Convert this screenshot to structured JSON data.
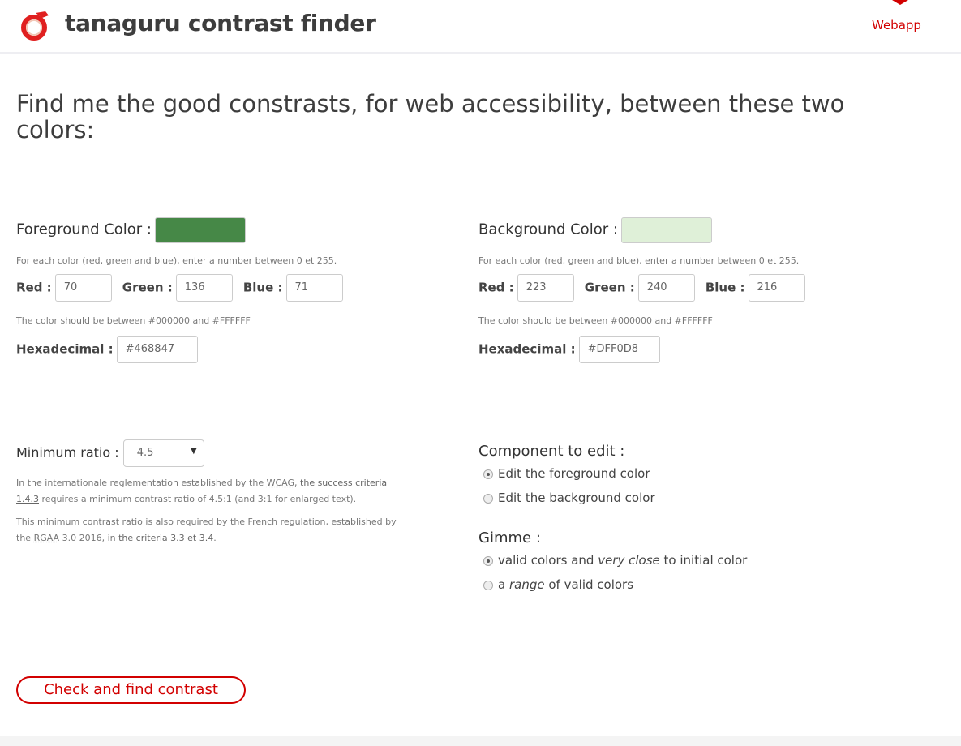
{
  "header": {
    "brand": "tanaguru contrast finder",
    "nav_link": "Webapp",
    "logo_icon": "dragon-logo-icon",
    "accent": "#d20000"
  },
  "title": "Find me the good constrasts, for web accessibility, between these two colors:",
  "foreground": {
    "label": "Foreground Color :",
    "swatch": "#468847",
    "hint": "For each color (red, green and blue), enter a number between 0 et 255.",
    "red_label": "Red :",
    "red": "70",
    "green_label": "Green :",
    "green": "136",
    "blue_label": "Blue :",
    "blue": "71",
    "range_hint": "The color should be between #000000 and #FFFFFF",
    "hex_label": "Hexadecimal :",
    "hex": "#468847"
  },
  "background": {
    "label": "Background Color :",
    "swatch": "#DFF0D8",
    "hint": "For each color (red, green and blue), enter a number between 0 et 255.",
    "red_label": "Red :",
    "red": "223",
    "green_label": "Green :",
    "green": "240",
    "blue_label": "Blue :",
    "blue": "216",
    "range_hint": "The color should be between #000000 and #FFFFFF",
    "hex_label": "Hexadecimal :",
    "hex": "#DFF0D8"
  },
  "ratio": {
    "label": "Minimum ratio :",
    "value": "4.5",
    "p1a": "In the internationale reglementation established by the ",
    "wcag": "WCAG",
    "p1b": ", ",
    "link1": "the success criteria 1.4.3",
    "p1c": " requires a minimum contrast ratio of 4.5:1 (and 3:1 for enlarged text).",
    "p2a": "This minimum contrast ratio is also required by the French regulation, established by the ",
    "rgaa": "RGAA",
    "p2b": " 3.0 2016, in ",
    "link2": "the criteria 3.3 et 3.4",
    "p2c": "."
  },
  "component": {
    "label": "Component to edit :",
    "options": [
      {
        "label": "Edit the foreground color",
        "checked": true
      },
      {
        "label": "Edit the background color",
        "checked": false
      }
    ]
  },
  "gimme": {
    "label": "Gimme :",
    "opt1a": "valid colors and ",
    "opt1b": "very close",
    "opt1c": " to initial color",
    "opt2a": "a ",
    "opt2b": "range",
    "opt2c": " of valid colors",
    "selected": 1
  },
  "submit": "Check and find contrast"
}
